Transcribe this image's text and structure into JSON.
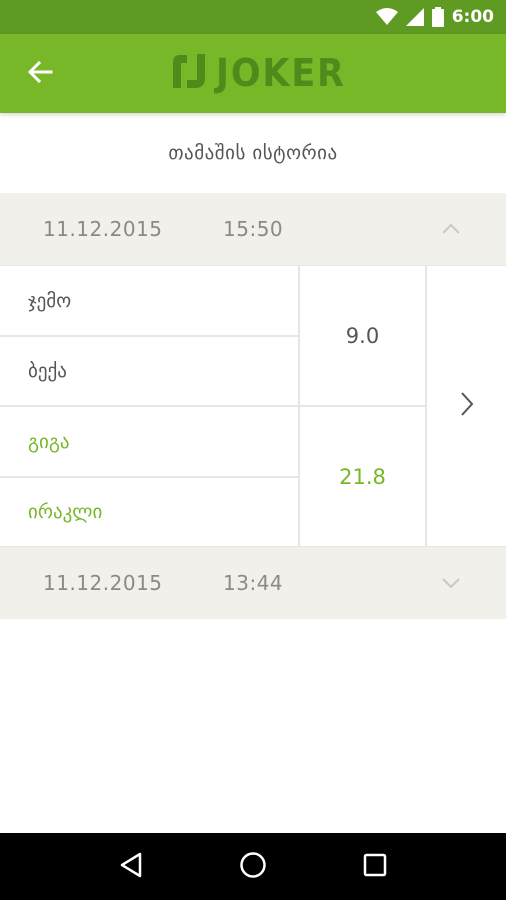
{
  "status_bar": {
    "time": "6:00",
    "icons": [
      "wifi-icon",
      "signal-icon",
      "battery-icon"
    ]
  },
  "app_bar": {
    "logo_text": "JOKER",
    "back_icon": "arrow-left-icon",
    "color": "#78b728"
  },
  "page": {
    "title": "თამაშის ისტორია"
  },
  "sessions": [
    {
      "date": "11.12.2015",
      "time": "15:50",
      "expanded": true,
      "teams": [
        {
          "players": [
            "ჯემო",
            "ბექა"
          ],
          "score": "9.0",
          "winner": false
        },
        {
          "players": [
            "გიგა",
            "ირაკლი"
          ],
          "score": "21.8",
          "winner": true
        }
      ]
    },
    {
      "date": "11.12.2015",
      "time": "13:44",
      "expanded": false
    }
  ],
  "colors": {
    "accent": "#78b728",
    "status_bar": "#5f9a22",
    "session_bg": "#f2f0ea",
    "text": "#555555"
  },
  "nav_bar": {
    "buttons": [
      "back-triangle-icon",
      "home-circle-icon",
      "recents-square-icon"
    ]
  }
}
